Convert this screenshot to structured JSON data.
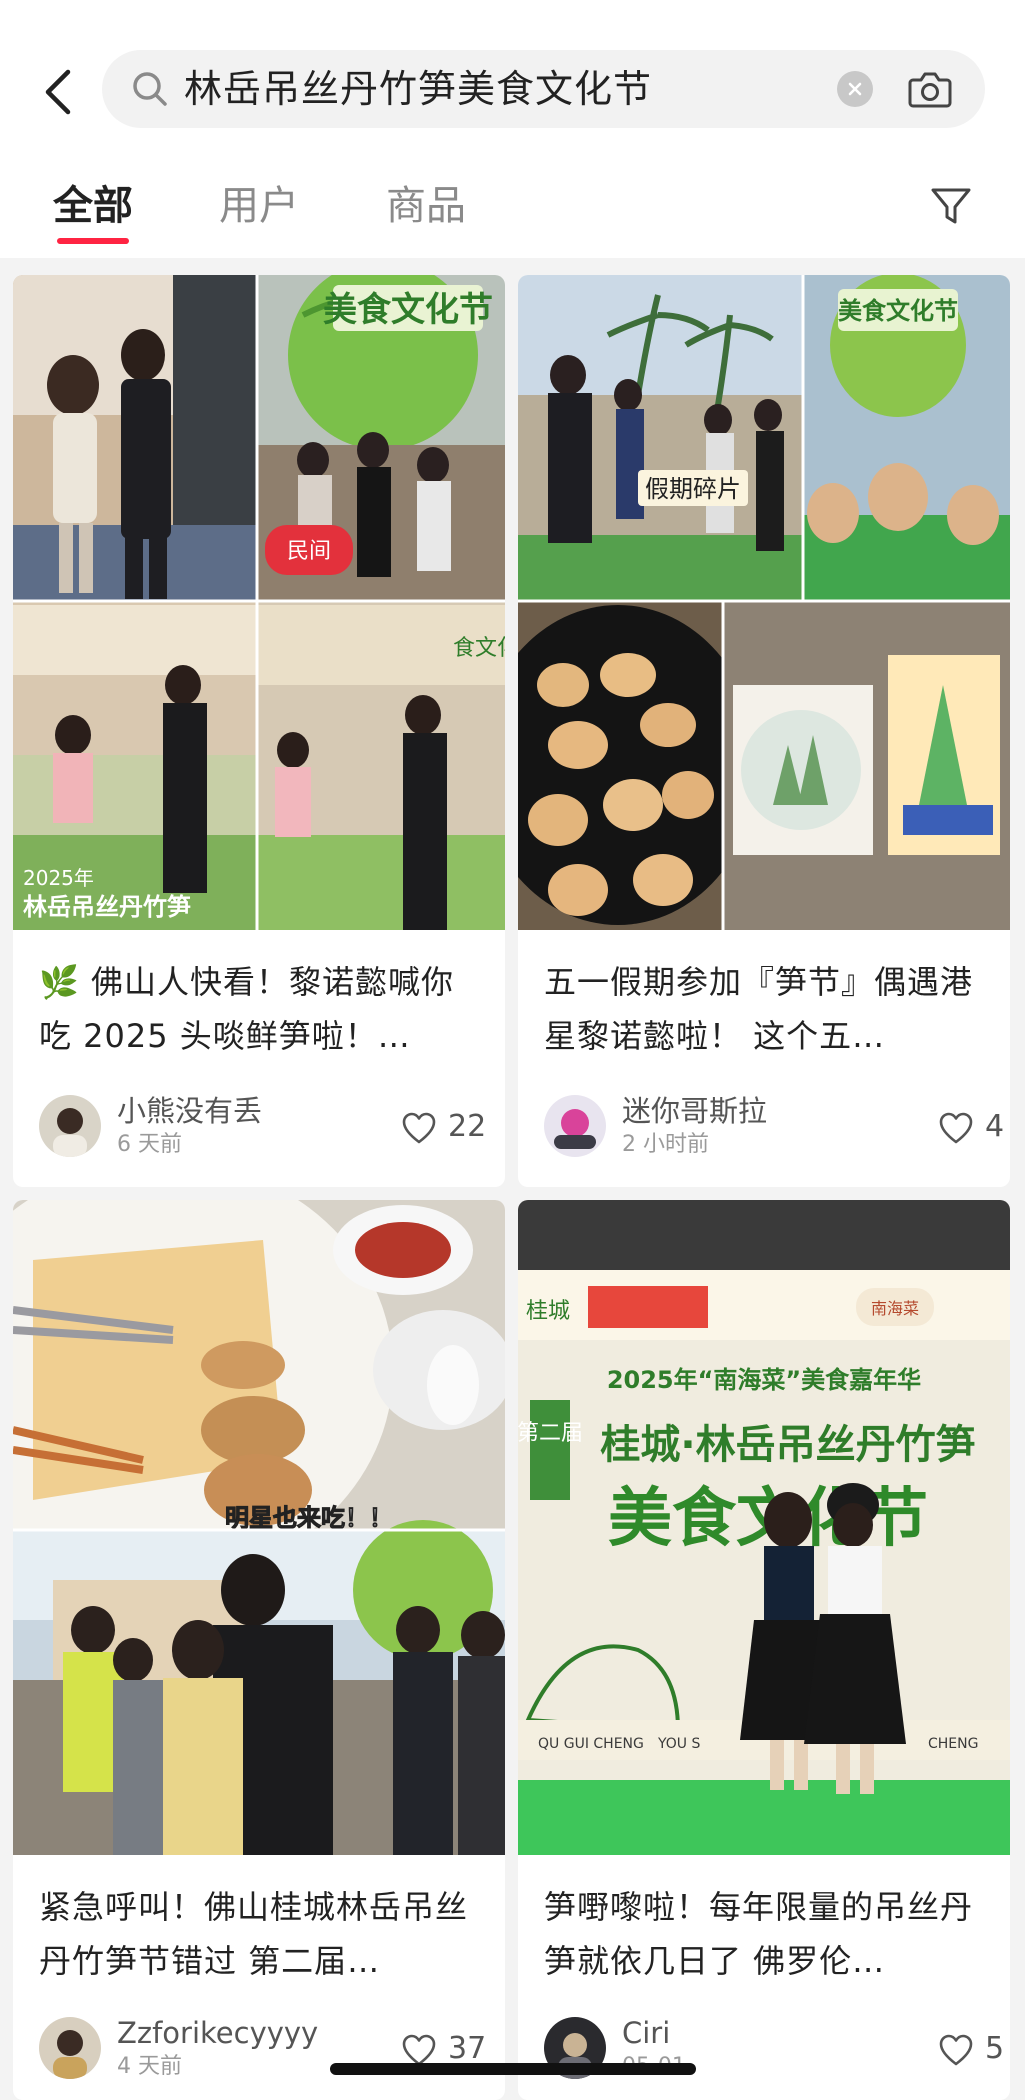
{
  "search": {
    "query": "林岳吊丝丹竹笋美食文化节"
  },
  "tabs": [
    {
      "label": "全部"
    },
    {
      "label": "用户"
    },
    {
      "label": "商品"
    }
  ],
  "colors": {
    "accent": "#ff2442",
    "background": "#f3f3f3",
    "card": "#ffffff"
  },
  "cards": [
    {
      "title": "🌿 佛山人快看！黎诺懿喊你吃 2025 头啖鲜笋啦！…",
      "author": "小熊没有丢",
      "time": "6 天前",
      "likes": "22",
      "image_texts": [
        "美食文化节",
        "民间",
        "2025年",
        "林岳吊丝丹竹笋",
        "食文化节"
      ]
    },
    {
      "title": "五一假期参加『笋节』偶遇港星黎诺懿啦！ 这个五…",
      "author": "迷你哥斯拉",
      "time": "2 小时前",
      "likes": "4",
      "image_texts": [
        "美食文化节",
        "假期碎片"
      ]
    },
    {
      "title": "紧急呼叫！佛山桂城林岳吊丝丹竹笋节错过 第二届…",
      "author": "Zzforikecyyyy",
      "time": "4 天前",
      "likes": "37",
      "image_texts": [
        "明星也来吃！！"
      ]
    },
    {
      "title": "笋嘢嚟啦！每年限量的吊丝丹笋就依几日了 佛罗伦…",
      "author": "Ciri",
      "time": "05-01",
      "likes": "5",
      "image_texts": [
        "2025年“南海菜”美食嘉年华",
        "第二届",
        "桂城·林岳吊丝丹竹笋",
        "美食文化节",
        "QU GUI CHENG",
        "YOU S",
        "CHENG",
        "桂城",
        "南海菜"
      ]
    }
  ],
  "icons": {
    "back": "chevron-left-icon",
    "search": "search-icon",
    "clear": "clear-icon",
    "camera": "camera-icon",
    "filter": "filter-icon",
    "like": "heart-icon"
  }
}
